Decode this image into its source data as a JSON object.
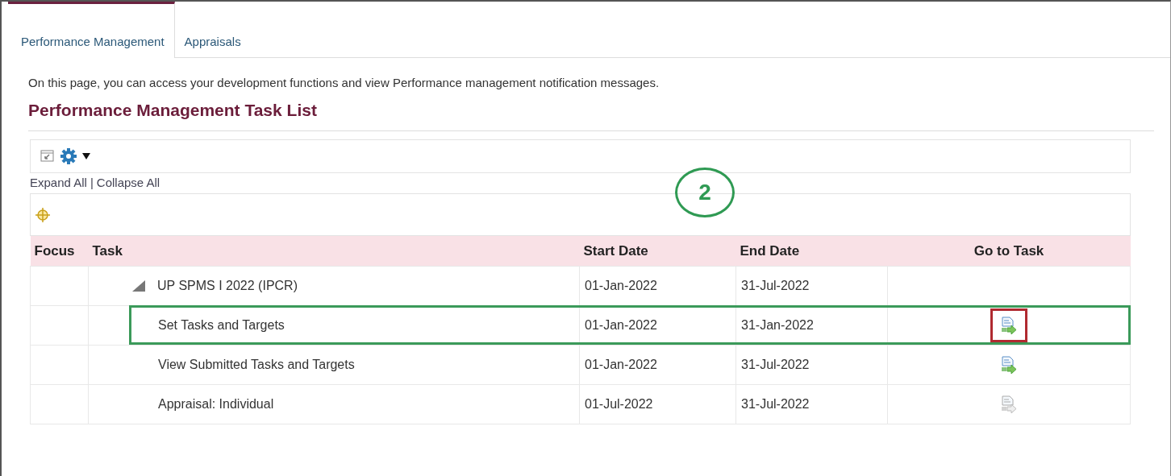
{
  "tabs": [
    {
      "label": "Performance Management",
      "selected": true
    },
    {
      "label": "Appraisals",
      "selected": false
    }
  ],
  "description": "On this page, you can access your development functions and view Performance management notification messages.",
  "heading": "Performance Management Task List",
  "toolbar": {
    "links": [
      "Expand All",
      "Collapse All"
    ],
    "separator": "|"
  },
  "callout": {
    "label": "2"
  },
  "table": {
    "columns": [
      "Focus",
      "Task",
      "Start Date",
      "End Date",
      "Go to Task"
    ],
    "rows": [
      {
        "task": "UP SPMS I 2022 (IPCR)",
        "start": "01-Jan-2022",
        "end": "31-Jul-2022",
        "expanded": true,
        "children": [
          {
            "task": "Set Tasks and Targets",
            "start": "01-Jan-2022",
            "end": "31-Jan-2022",
            "enabled": true,
            "highlighted": true,
            "icon_highlighted": true
          },
          {
            "task": "View Submitted Tasks and Targets",
            "start": "01-Jan-2022",
            "end": "31-Jul-2022",
            "enabled": true,
            "highlighted": false,
            "icon_highlighted": false
          },
          {
            "task": "Appraisal: Individual",
            "start": "01-Jul-2022",
            "end": "31-Jul-2022",
            "enabled": false,
            "highlighted": false,
            "icon_highlighted": false
          }
        ]
      }
    ]
  }
}
